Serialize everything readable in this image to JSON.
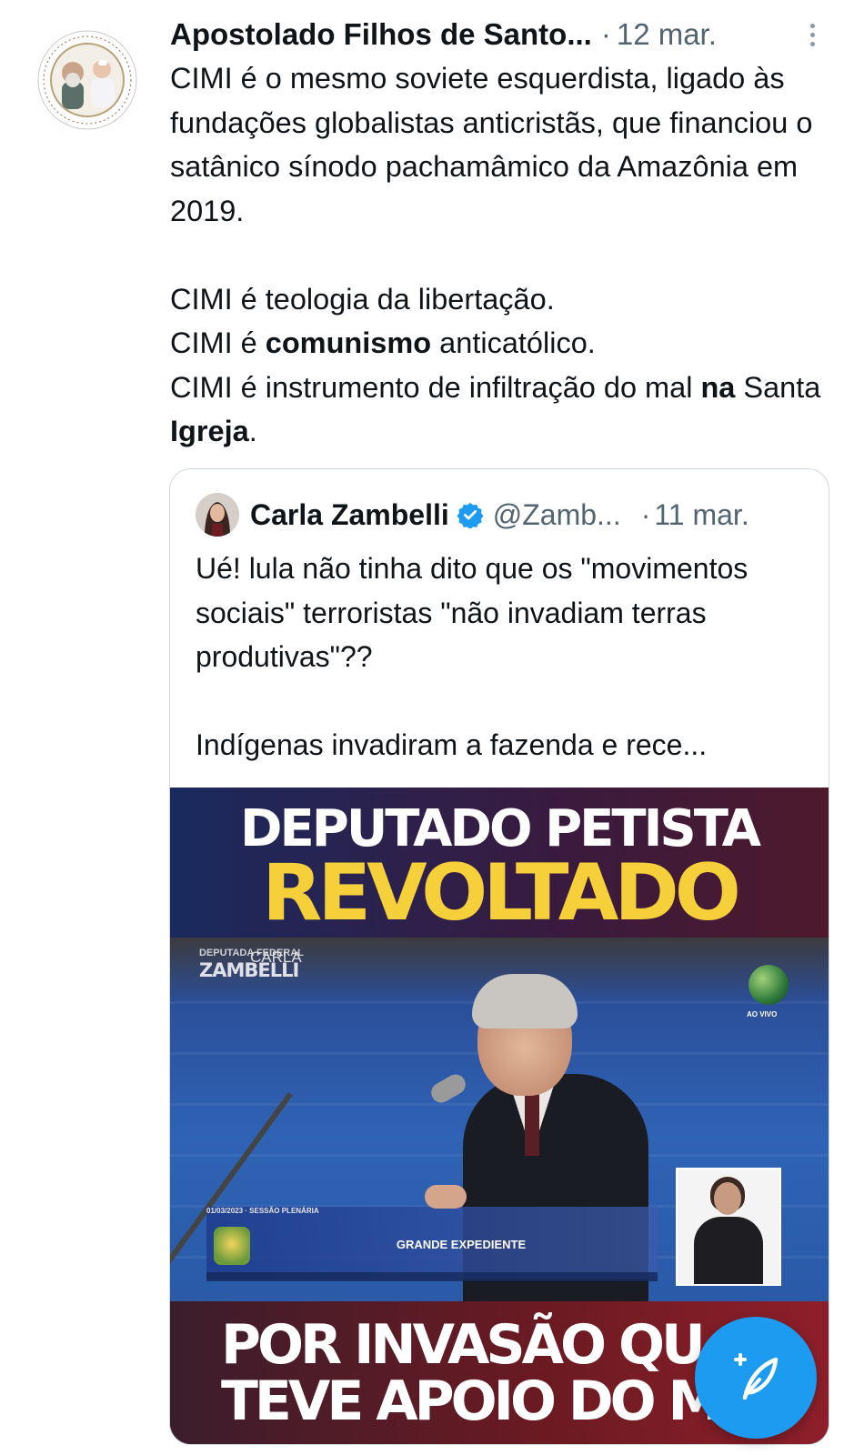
{
  "post": {
    "author": "Apostolado Filhos de Santo...",
    "separator": "·",
    "date": "12 mar.",
    "paragraph1": "CIMI é o mesmo soviete esquerdista, ligado às fundações globalistas anticristãs, que financiou o satânico sínodo pachamâmico da Amazônia em 2019.",
    "line2": "CIMI é teologia da libertação.",
    "line3_a": "CIMI é ",
    "line3_bold": "comunismo",
    "line3_b": " anticatólico.",
    "line4_a": "CIMI é instrumento de infiltração do mal ",
    "line4_bold1": "na",
    "line4_b": " Santa ",
    "line4_bold2": "Igreja",
    "line4_c": "."
  },
  "quote": {
    "author": "Carla Zambelli",
    "handle": "@Zamb...",
    "separator": "·",
    "date": "11 mar.",
    "paragraph1": "Ué! lula não tinha dito que os \"movimentos sociais\" terroristas \"não invadiam terras produtivas\"??",
    "paragraph2": "Indígenas invadiram a fazenda e rece..."
  },
  "media": {
    "headline_top": "DEPUTADO PETISTA",
    "headline_main": "REVOLTADO",
    "watermark_small": "DEPUTADA FEDERAL",
    "watermark_carla": "CARLA",
    "watermark_name": "ZAMBELLI",
    "live_label": "AO VIVO",
    "session_label": "01/03/2023 · SESSÃO PLENÁRIA",
    "lower_third": "GRANDE EXPEDIENTE",
    "headline_bottom1": "POR INVASÃO QU",
    "headline_bottom2": "TEVE APOIO DO M"
  },
  "colors": {
    "accent": "#1d9bf0",
    "headline_yellow": "#f5d03a",
    "muted_text": "#536471"
  },
  "icons": {
    "more": "more-vertical-icon",
    "verified": "verified-badge-icon",
    "compose": "compose-post-icon"
  }
}
